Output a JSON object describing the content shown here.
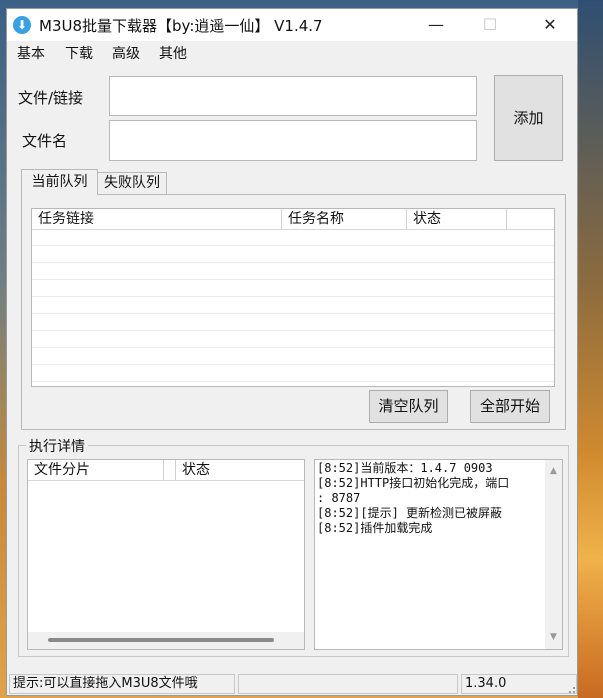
{
  "window": {
    "title": "M3U8批量下载器【by:逍遥一仙】 V1.4.7"
  },
  "menu": [
    "基本",
    "下载",
    "高级",
    "其他"
  ],
  "form": {
    "url_label": "文件/链接",
    "name_label": "文件名",
    "url_value": "",
    "name_value": "",
    "add_button": "添加"
  },
  "tabs": [
    "当前队列",
    "失败队列"
  ],
  "queue": {
    "columns": [
      "任务链接",
      "任务名称",
      "状态"
    ],
    "rows": [],
    "clear_button": "清空队列",
    "start_all_button": "全部开始"
  },
  "details": {
    "title": "执行详情",
    "columns": [
      "文件分片",
      "状态"
    ],
    "log_lines": [
      "[8:52]当前版本：1.4.7 0903",
      "[8:52]HTTP接口初始化完成，端口",
      ": 8787",
      "[8:52][提示] 更新检测已被屏蔽",
      "[8:52]插件加载完成"
    ]
  },
  "status_bar": {
    "hint": "提示:可以直接拖入M3U8文件哦",
    "middle": "",
    "version": "1.34.0"
  }
}
